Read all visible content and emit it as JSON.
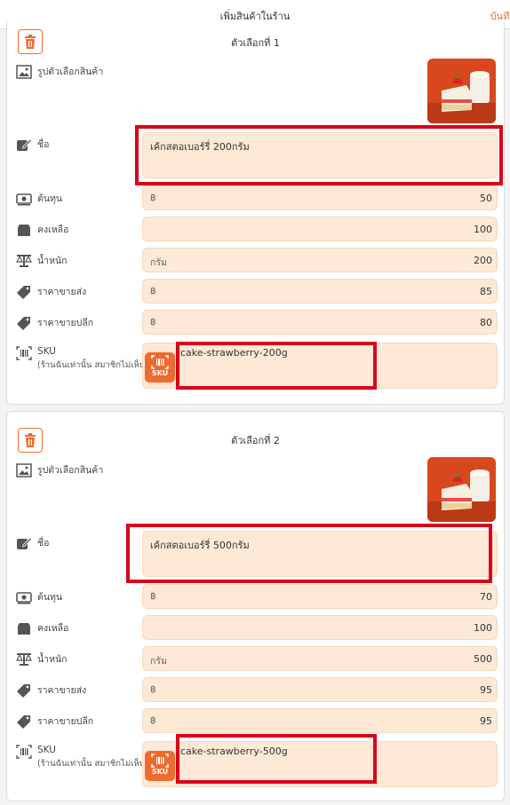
{
  "header": {
    "title": "เพิ่มสินค้าในร้าน",
    "save_label": "บันทึก"
  },
  "labels": {
    "image": "รูปตัวเลือกสินค้า",
    "name": "ชื่อ",
    "cost": "ต้นทุน",
    "stock": "คงเหลือ",
    "weight": "น้ำหนัก",
    "wholesale": "ราคาขายส่ง",
    "retail": "ราคาขายปลีก",
    "sku": "SKU",
    "sku_note": "(ร้านฉันเท่านั้น สมาชิกไม่เห็น)",
    "currency": "฿",
    "weight_unit": "กรัม",
    "sku_button": "SKU"
  },
  "options": [
    {
      "title": "ตัวเลือกที่ 1",
      "name": "เค้กสตอเบอร์รี่ 200กรัม",
      "cost": "50",
      "stock": "100",
      "weight": "200",
      "wholesale": "85",
      "retail": "80",
      "sku": "cake-strawberry-200g"
    },
    {
      "title": "ตัวเลือกที่ 2",
      "name": "เค้กสตอเบอร์รี่ 500กรัม",
      "cost": "70",
      "stock": "100",
      "weight": "500",
      "wholesale": "95",
      "retail": "95",
      "sku": "cake-strawberry-500g"
    }
  ],
  "colors": {
    "accent": "#ef6a2e",
    "field_bg": "#fde9d6",
    "highlight": "#d9001b"
  }
}
